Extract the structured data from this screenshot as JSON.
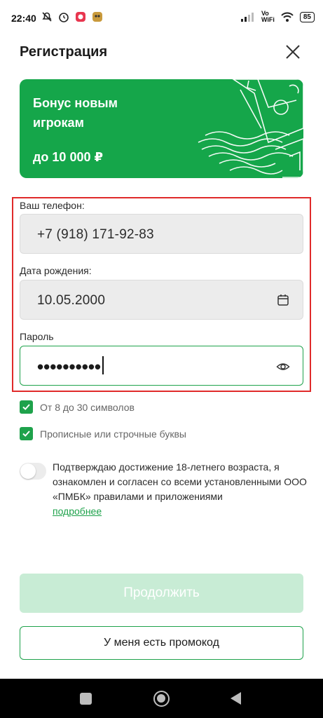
{
  "status_bar": {
    "time": "22:40",
    "vowifi_top": "Vo",
    "vowifi_bottom": "WiFi",
    "battery": "85",
    "icons": [
      "muted-alarm-icon",
      "alarm-clock-icon",
      "app-notification-icon",
      "app-notification-icon-2",
      "signal-icon",
      "wifi-icon",
      "battery-icon"
    ]
  },
  "header": {
    "title": "Регистрация",
    "close_icon": "close-icon"
  },
  "banner": {
    "title": "Бонус новым игрокам",
    "amount": "до 10 000 ₽",
    "color": "#15a64a"
  },
  "form": {
    "phone": {
      "label": "Ваш телефон:",
      "value": "+7 (918) 171-92-83"
    },
    "birthdate": {
      "label": "Дата рождения:",
      "value": "10.05.2000",
      "icon": "calendar-icon"
    },
    "password": {
      "label": "Пароль",
      "value": "••••••••••",
      "icon": "eye-icon"
    }
  },
  "rules": [
    {
      "text": "От 8 до 30 символов",
      "checked": true
    },
    {
      "text": "Прописные или строчные буквы",
      "checked": true
    }
  ],
  "consent": {
    "text": "Подтверждаю достижение 18-летнего возраста, я ознакомлен и согласен со всеми установленными ООО «ПМБК» правилами и приложениями",
    "link": "подробнее",
    "toggle_on": false
  },
  "buttons": {
    "continue": "Продолжить",
    "promo": "У меня есть промокод"
  },
  "colors": {
    "accent": "#1ea24b",
    "highlight_border": "#e02a2a",
    "disabled_button": "#c8ecd5"
  }
}
